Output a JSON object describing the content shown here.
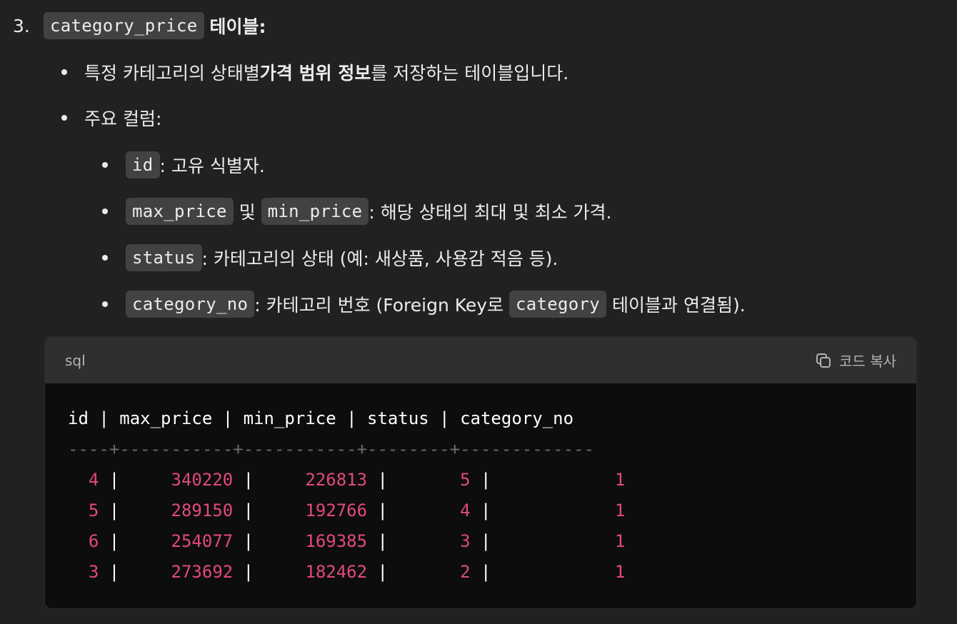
{
  "section": {
    "number": "3.",
    "table_code": "category_price",
    "table_suffix": "테이블:"
  },
  "bullets": [
    {
      "pre": "특정 카테고리의 상태별 ",
      "bold": "가격 범위 정보",
      "post": "를 저장하는 테이블입니다."
    },
    {
      "text": "주요 컬럼:"
    }
  ],
  "columns": [
    {
      "code": "id",
      "desc": ": 고유 식별자."
    },
    {
      "code": "max_price",
      "mid": " 및 ",
      "code2": "min_price",
      "desc": ": 해당 상태의 최대 및 최소 가격."
    },
    {
      "code": "status",
      "desc": ": 카테고리의 상태 (예: 새상품, 사용감 적음 등)."
    },
    {
      "code": "category_no",
      "desc": ": 카테고리 번호 (Foreign Key로 ",
      "code2": "category",
      "desc2": " 테이블과 연결됨)."
    }
  ],
  "codeblock": {
    "language": "sql",
    "copy_label": "코드 복사",
    "header_line": "id | max_price | min_price | status | category_no",
    "separator_line": "----+-----------+-----------+--------+-------------",
    "rows": [
      [
        "4",
        "340220",
        "226813",
        "5",
        "1"
      ],
      [
        "5",
        "289150",
        "192766",
        "4",
        "1"
      ],
      [
        "6",
        "254077",
        "169385",
        "3",
        "1"
      ],
      [
        "3",
        "273692",
        "182462",
        "2",
        "1"
      ]
    ]
  }
}
